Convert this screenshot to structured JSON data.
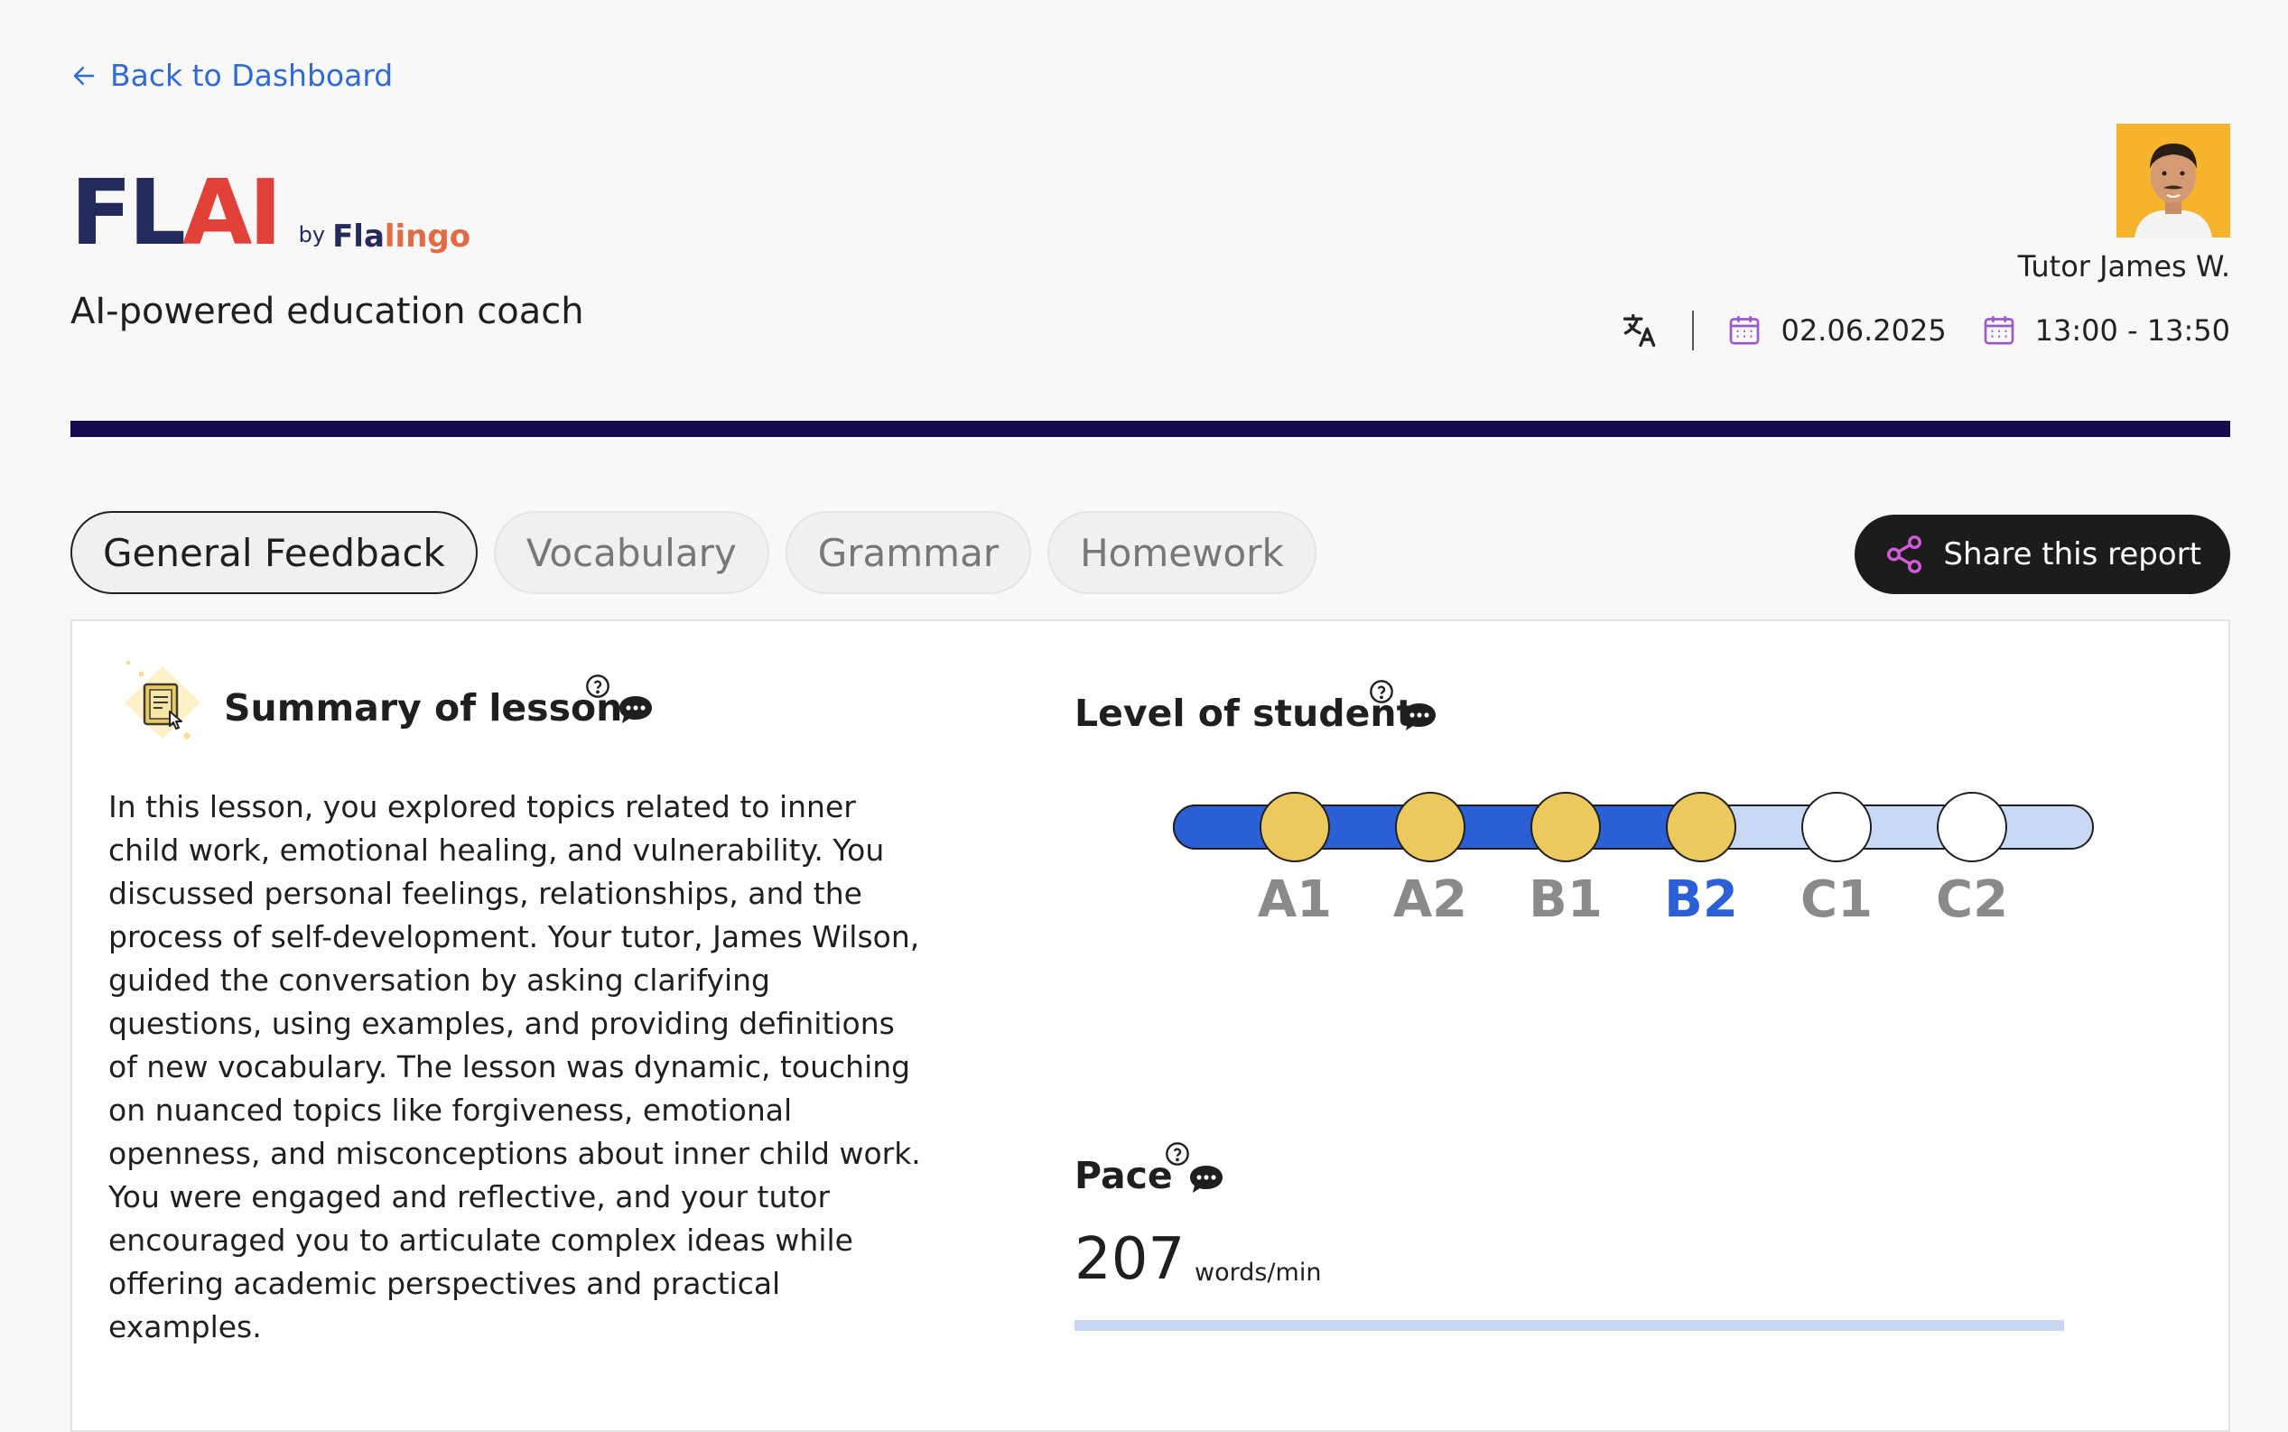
{
  "nav": {
    "back_label": "Back to Dashboard"
  },
  "logo": {
    "fl": "FL",
    "ai": "AI",
    "by": "by",
    "brand_a": "Fla",
    "brand_b": "lingo"
  },
  "subtitle": "AI-powered education coach",
  "tutor": {
    "name": "Tutor James W."
  },
  "meta": {
    "date": "02.06.2025",
    "time": "13:00 - 13:50"
  },
  "tabs": [
    {
      "label": "General Feedback",
      "active": true
    },
    {
      "label": "Vocabulary",
      "active": false
    },
    {
      "label": "Grammar",
      "active": false
    },
    {
      "label": "Homework",
      "active": false
    }
  ],
  "share_label": "Share this report",
  "summary": {
    "title": "Summary of lesson",
    "text": "In this lesson, you explored topics related to inner child work, emotional healing, and vulnerability. You discussed personal feelings, relationships, and the process of self-development. Your tutor, James Wilson, guided the conversation by asking clarifying questions, using examples, and providing definitions of new vocabulary. The lesson was dynamic, touching on nuanced topics like forgiveness, emotional openness, and misconceptions about inner child work. You were engaged and reflective, and your tutor encouraged you to articulate complex ideas while offering academic perspectives and practical examples."
  },
  "level": {
    "title": "Level of student",
    "levels": [
      "A1",
      "A2",
      "B1",
      "B2",
      "C1",
      "C2"
    ],
    "current": "B2"
  },
  "pace": {
    "title": "Pace",
    "value": "207",
    "unit": "words/min"
  },
  "colors": {
    "accent_blue": "#2f6ad8",
    "divider": "#150a4e",
    "level_done": "#ecc95d",
    "level_track": "#2a5fd6",
    "level_track_light": "#c9d9f5",
    "calendar_purple": "#9b59c9"
  }
}
